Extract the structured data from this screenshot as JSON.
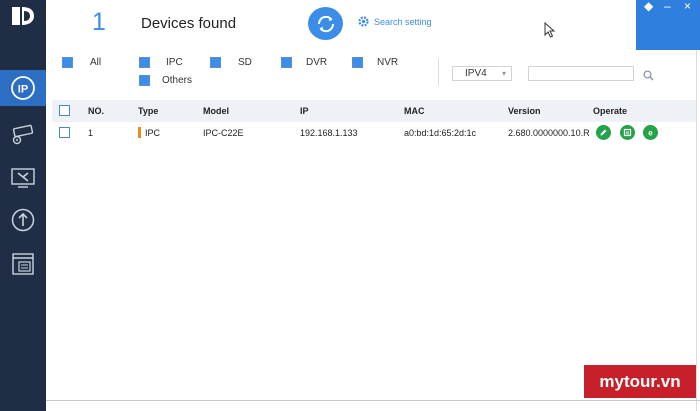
{
  "header": {
    "device_count": "1",
    "title": "Devices found",
    "search_setting_label": "Search setting"
  },
  "filters": {
    "all": "All",
    "ipc": "IPC",
    "sd": "SD",
    "dvr": "DVR",
    "nvr": "NVR",
    "others": "Others"
  },
  "protocol_select": {
    "selected": "IPV4"
  },
  "search": {
    "value": ""
  },
  "table": {
    "columns": {
      "no": "NO.",
      "type": "Type",
      "model": "Model",
      "ip": "IP",
      "mac": "MAC",
      "version": "Version",
      "operate": "Operate"
    },
    "rows": [
      {
        "no": "1",
        "type": "IPC",
        "model": "IPC-C22E",
        "ip": "192.168.1.133",
        "mac": "a0:bd:1d:65:2d:1c",
        "version": "2.680.0000000.10.R"
      }
    ]
  },
  "watermark": "mytour.vn",
  "colors": {
    "sidebar": "#1f2e45",
    "accent": "#3b8de8",
    "operate_green": "#25a34a",
    "type_marker": "#f08a1c",
    "watermark": "#c6202a"
  },
  "icons": {
    "sidebar": [
      "app-logo-icon",
      "ip-device-icon",
      "camera-settings-icon",
      "tools-icon",
      "upgrade-icon",
      "window-list-icon"
    ],
    "operate": [
      "edit-icon",
      "web-icon",
      "config-icon"
    ]
  }
}
